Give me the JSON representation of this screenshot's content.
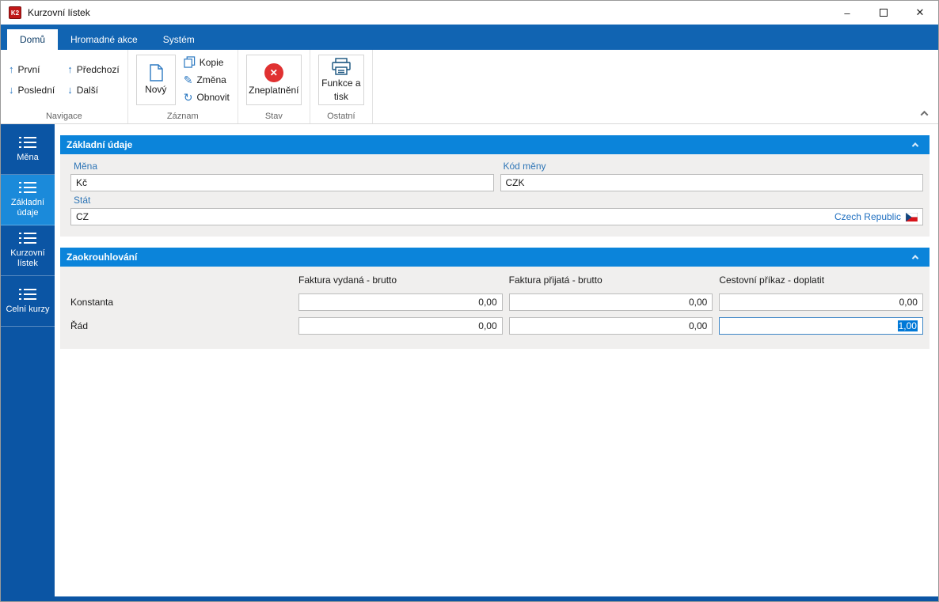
{
  "window": {
    "title": "Kurzovní lístek",
    "minimize_glyph": "–",
    "close_glyph": "✕"
  },
  "ribbon": {
    "tabs": [
      {
        "label": "Domů",
        "active": true
      },
      {
        "label": "Hromadné akce",
        "active": false
      },
      {
        "label": "Systém",
        "active": false
      }
    ],
    "nav": {
      "first": "První",
      "last": "Poslední",
      "prev": "Předchozí",
      "next": "Další",
      "up_glyph": "↑",
      "down_glyph": "↓"
    },
    "record": {
      "new": "Nový",
      "copy": "Kopie",
      "change": "Změna",
      "refresh": "Obnovit",
      "pencil_glyph": "✎",
      "refresh_glyph": "↻"
    },
    "state": {
      "invalidate": "Zneplatnění",
      "x_glyph": "✕"
    },
    "other": {
      "functions_line1": "Funkce a",
      "functions_line2": "tisk"
    },
    "group_labels": {
      "navigation": "Navigace",
      "record": "Záznam",
      "state": "Stav",
      "other": "Ostatní"
    }
  },
  "sidebar": {
    "items": [
      {
        "label": "Měna",
        "active": false
      },
      {
        "label": "Základní údaje",
        "active": true
      },
      {
        "label": "Kurzovní lístek",
        "active": false
      },
      {
        "label": "Celní kurzy",
        "active": false
      }
    ]
  },
  "basic_panel": {
    "title": "Základní údaje",
    "currency_label": "Měna",
    "currency_value": "Kč",
    "code_label": "Kód měny",
    "code_value": "CZK",
    "state_label": "Stát",
    "state_value": "CZ",
    "state_country": "Czech Republic"
  },
  "rounding_panel": {
    "title": "Zaokrouhlování",
    "columns": [
      "Faktura vydaná - brutto",
      "Faktura přijatá - brutto",
      "Cestovní příkaz - doplatit"
    ],
    "rows": [
      {
        "label": "Konstanta",
        "values": [
          "0,00",
          "0,00",
          "0,00"
        ]
      },
      {
        "label": "Řád",
        "values": [
          "0,00",
          "0,00",
          "1,00"
        ],
        "selected_column": 2
      }
    ]
  },
  "colors": {
    "accent_blue": "#1164b2",
    "sidebar_blue": "#0b55a4",
    "active_item_blue": "#1b8ada",
    "panel_header_blue": "#0b84da",
    "label_blue": "#2e75b6",
    "selection_blue": "#0078d7",
    "invalid_red": "#e03131"
  }
}
